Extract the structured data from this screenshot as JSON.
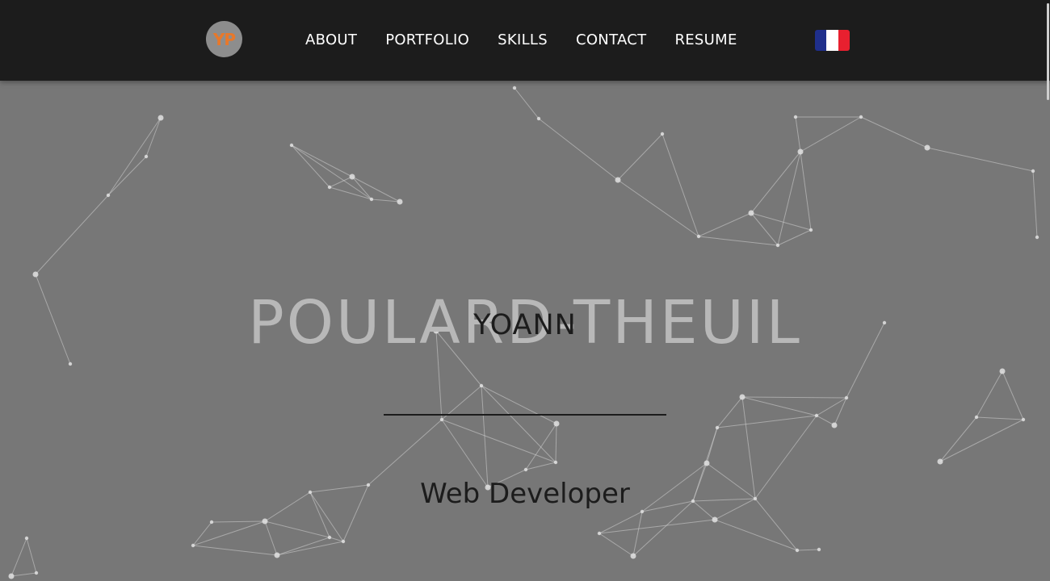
{
  "navbar": {
    "logo_text": "YP",
    "links": [
      "ABOUT",
      "PORTFOLIO",
      "SKILLS",
      "CONTACT",
      "RESUME"
    ],
    "language_flag": {
      "name": "france-flag-icon",
      "colors": [
        "#1f2f8c",
        "#ffffff",
        "#e8202f"
      ]
    }
  },
  "hero": {
    "last_name": "POULARD-THEUIL",
    "first_name": "YOANN",
    "role": "Web Developer"
  },
  "colors": {
    "navbar_background": "#1c1c1c",
    "page_background": "#777777",
    "logo_accent": "#e8782a",
    "logo_background": "#8d8d8d"
  }
}
